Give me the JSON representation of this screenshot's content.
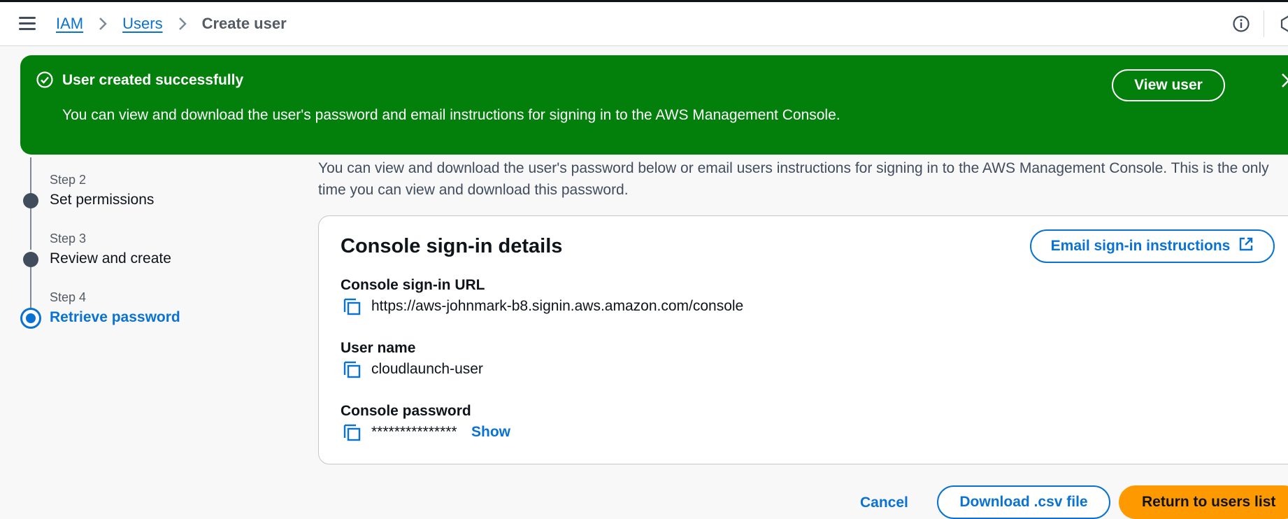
{
  "breadcrumb": {
    "items": [
      "IAM",
      "Users"
    ],
    "current": "Create user"
  },
  "flash": {
    "title": "User created successfully",
    "message": "You can view and download the user's password and email instructions for signing in to the AWS Management Console.",
    "view_user_label": "View user",
    "color": "#037f0c"
  },
  "steps": [
    {
      "number": "Step 2",
      "title": "Set permissions"
    },
    {
      "number": "Step 3",
      "title": "Review and create"
    },
    {
      "number": "Step 4",
      "title": "Retrieve password"
    }
  ],
  "intro": "You can view and download the user's password below or email users instructions for signing in to the AWS Management Console. This is the only time you can view and download this password.",
  "card": {
    "title": "Console sign-in details",
    "email_button_label": "Email sign-in instructions",
    "fields": {
      "url_label": "Console sign-in URL",
      "url_value": "https://aws-johnmark-b8.signin.aws.amazon.com/console",
      "username_label": "User name",
      "username_value": "cloudlaunch-user",
      "password_label": "Console password",
      "password_value": "***************",
      "show_label": "Show"
    }
  },
  "actions": {
    "cancel": "Cancel",
    "download": "Download .csv file",
    "return": "Return to users list"
  },
  "colors": {
    "link": "#0972d3",
    "primary": "#ff9900",
    "success": "#037f0c"
  }
}
